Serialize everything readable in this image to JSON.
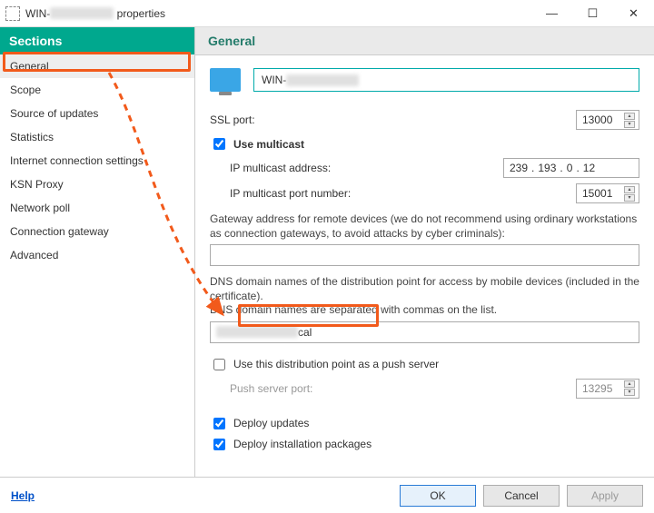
{
  "window": {
    "title_prefix": "WIN-",
    "title_suffix": " properties"
  },
  "sidebar": {
    "header": "Sections",
    "items": [
      {
        "label": "General"
      },
      {
        "label": "Scope"
      },
      {
        "label": "Source of updates"
      },
      {
        "label": "Statistics"
      },
      {
        "label": "Internet connection settings"
      },
      {
        "label": "KSN Proxy"
      },
      {
        "label": "Network poll"
      },
      {
        "label": "Connection gateway"
      },
      {
        "label": "Advanced"
      }
    ]
  },
  "general": {
    "header": "General",
    "host_prefix": "WIN-",
    "ssl_port_label": "SSL port:",
    "ssl_port": "13000",
    "use_multicast_label": "Use multicast",
    "use_multicast_checked": true,
    "ip_multicast_addr_label": "IP multicast address:",
    "ip_multicast_addr": {
      "a": "239",
      "b": "193",
      "c": "0",
      "d": "12"
    },
    "ip_multicast_port_label": "IP multicast port number:",
    "ip_multicast_port": "15001",
    "gateway_para": "Gateway address for remote devices (we do not recommend using ordinary workstations as connection gateways, to avoid attacks by cyber criminals):",
    "gateway_value": "",
    "dns_para_line1": "DNS domain names of the distribution point for access by mobile devices (included in the certificate).",
    "dns_para_line2": "DNS domain names are separated with commas on the list.",
    "dns_suffix": "cal",
    "push_cb_label": "Use this distribution point as a push server",
    "push_cb_checked": false,
    "push_port_label": "Push server port:",
    "push_port": "13295",
    "deploy_updates_label": "Deploy updates",
    "deploy_updates_checked": true,
    "deploy_pkg_label": "Deploy installation packages",
    "deploy_pkg_checked": true
  },
  "footer": {
    "help": "Help",
    "ok": "OK",
    "cancel": "Cancel",
    "apply": "Apply"
  }
}
